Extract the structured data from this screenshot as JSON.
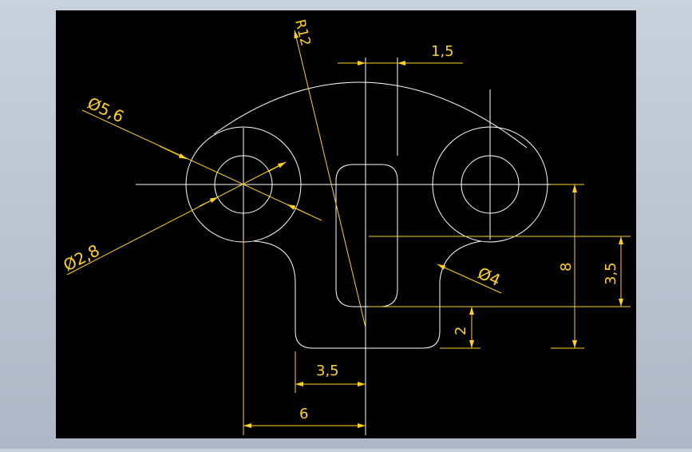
{
  "colors": {
    "background_frame": "#b8c2cf",
    "canvas": "#000000",
    "geometry": "#ffffff",
    "dimension": "#ffd21f"
  },
  "dimensions": {
    "radius": "R12",
    "dia_outer": "Ø5,6",
    "dia_inner": "Ø2,8",
    "dia_right": "Ø4",
    "top_offset": "1,5",
    "height_total": "8",
    "height_right": "3,5",
    "step_height": "2",
    "width_inner": "3,5",
    "width_total": "6"
  }
}
